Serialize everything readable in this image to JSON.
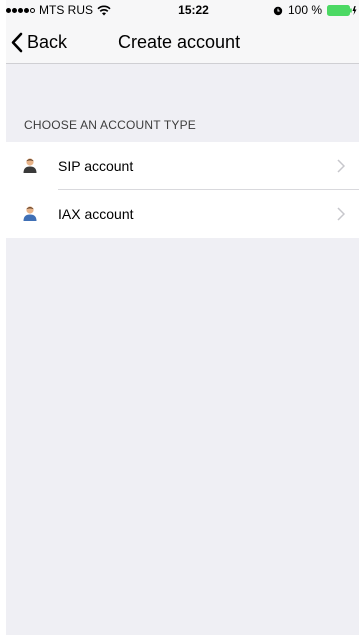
{
  "status_bar": {
    "carrier": "MTS RUS",
    "time": "15:22",
    "battery": "100 %",
    "battery_color": "#4cd964"
  },
  "nav": {
    "back_label": "Back",
    "title": "Create account"
  },
  "section": {
    "header": "CHOOSE AN ACCOUNT TYPE"
  },
  "accounts": [
    {
      "label": "SIP account",
      "icon": "user-icon"
    },
    {
      "label": "IAX account",
      "icon": "user-icon"
    }
  ],
  "colors": {
    "background": "#efeff4",
    "bar_background": "#f7f7f8"
  }
}
